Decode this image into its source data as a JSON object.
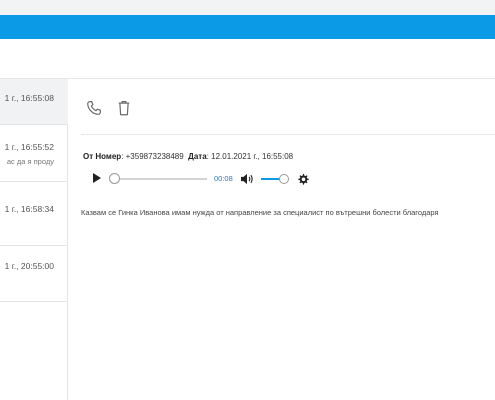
{
  "colors": {
    "accent": "#0a9ae6",
    "selected_row": "#f0f2f4",
    "time_text": "#2b7bd3"
  },
  "messages": [
    {
      "date": "1 г., 16:55:08",
      "preview": ""
    },
    {
      "date": "1 г., 16:55:52",
      "preview": "ас да я проду"
    },
    {
      "date": "1 г., 16:58:34",
      "preview": ""
    },
    {
      "date": "1 г., 20:55:00",
      "preview": ""
    }
  ],
  "detail": {
    "actions": {
      "call_icon": "phone-icon",
      "delete_icon": "trash-icon"
    },
    "from_label": "От Номер",
    "from_value": ": +359873238489",
    "date_label": "Дата",
    "date_value": ": 12.01.2021 г., 16:55:08",
    "player": {
      "time": "00:08",
      "progress": 0,
      "volume": 0.8
    },
    "message_text": "Казвам се Гинка Иванова имам нужда от направление за специалист по вътрешни болести благодаря"
  }
}
